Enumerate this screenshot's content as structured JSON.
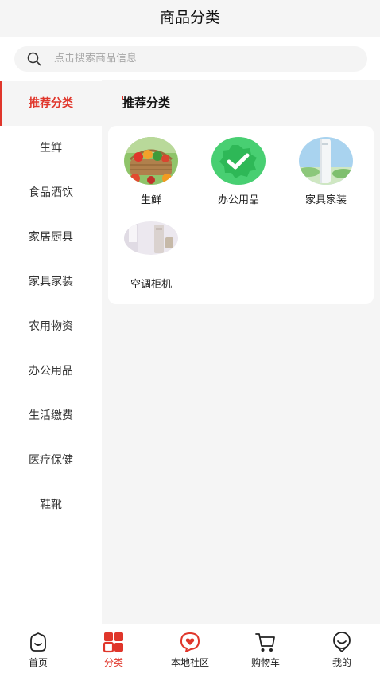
{
  "header": {
    "title": "商品分类"
  },
  "search": {
    "placeholder": "点击搜索商品信息"
  },
  "sidebar": {
    "items": [
      {
        "label": "推荐分类",
        "active": true
      },
      {
        "label": "生鲜"
      },
      {
        "label": "食品酒饮"
      },
      {
        "label": "家居厨具"
      },
      {
        "label": "家具家装"
      },
      {
        "label": "农用物资"
      },
      {
        "label": "办公用品"
      },
      {
        "label": "生活缴费"
      },
      {
        "label": "医疗保健"
      },
      {
        "label": "鞋靴"
      }
    ]
  },
  "main": {
    "section_title": "推荐分类",
    "categories": [
      {
        "label": "生鲜",
        "icon": "fresh-produce-basket-image"
      },
      {
        "label": "办公用品",
        "icon": "green-badge-check-icon"
      },
      {
        "label": "家具家装",
        "icon": "air-conditioner-tower-image"
      },
      {
        "label": "空调柜机",
        "icon": "room-air-conditioner-image"
      }
    ]
  },
  "bottom_nav": {
    "items": [
      {
        "label": "首页",
        "icon": "home-face-icon"
      },
      {
        "label": "分类",
        "icon": "category-grid-icon",
        "active": true
      },
      {
        "label": "本地社区",
        "icon": "community-heart-icon"
      },
      {
        "label": "购物车",
        "icon": "shopping-cart-icon"
      },
      {
        "label": "我的",
        "icon": "profile-face-icon"
      }
    ]
  },
  "colors": {
    "accent": "#e0362b",
    "background": "#f5f5f5",
    "text": "#222222"
  }
}
